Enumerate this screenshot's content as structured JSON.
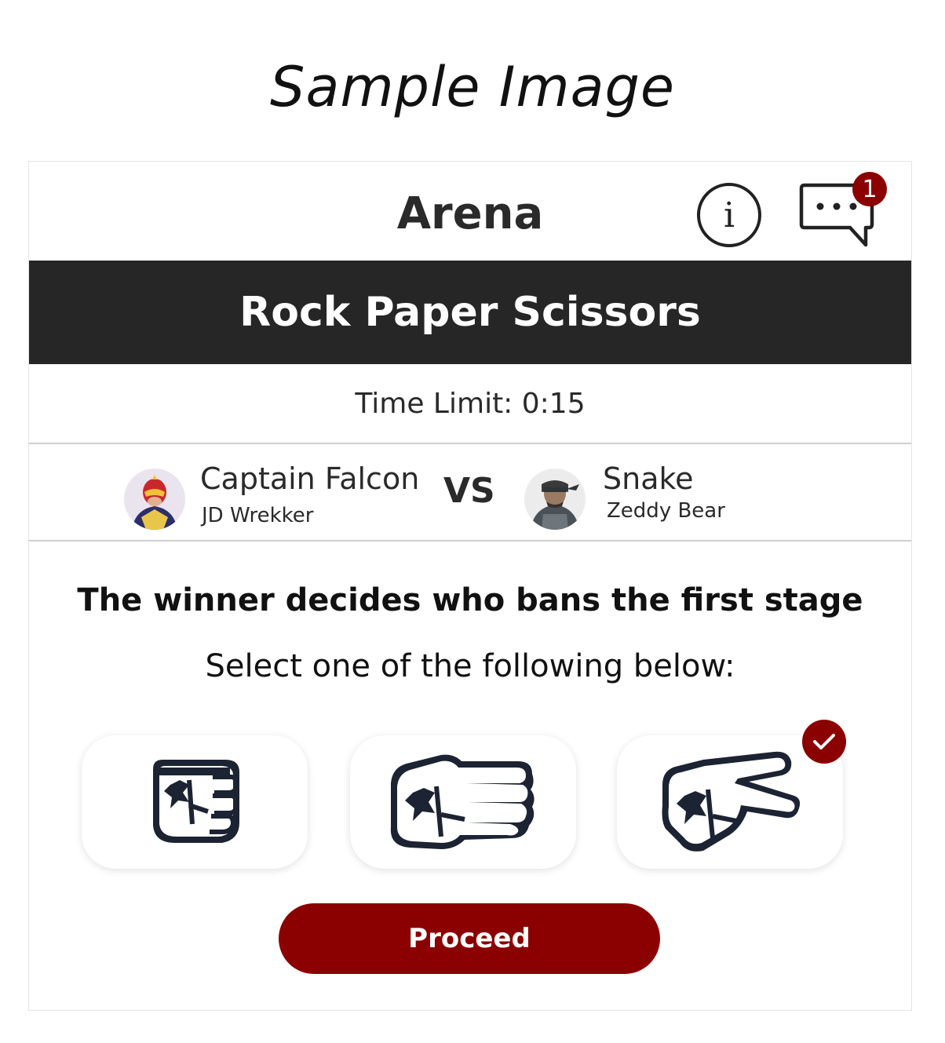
{
  "sample_caption": "Sample Image",
  "header": {
    "title": "Arena",
    "info_icon": "info-icon",
    "chat_icon": "chat-bubble-icon",
    "chat_badge_count": "1"
  },
  "banner": {
    "title": "Rock Paper Scissors"
  },
  "timer": {
    "label": "Time Limit: 0:15"
  },
  "matchup": {
    "vs_label": "VS",
    "player1": {
      "character": "Captain Falcon",
      "tag": "JD Wrekker",
      "avatar_icon": "captain-falcon-avatar"
    },
    "player2": {
      "character": "Snake",
      "tag": "Zeddy Bear",
      "avatar_icon": "snake-avatar"
    }
  },
  "prompt": {
    "heading": "The winner decides who bans the first stage",
    "subheading": "Select one of the following below:"
  },
  "choices": [
    {
      "id": "rock",
      "icon": "rock-fist-icon",
      "selected": false
    },
    {
      "id": "paper",
      "icon": "paper-hand-icon",
      "selected": false
    },
    {
      "id": "scissors",
      "icon": "scissors-hand-icon",
      "selected": true
    }
  ],
  "actions": {
    "proceed_label": "Proceed"
  },
  "colors": {
    "accent": "#8b0000",
    "banner_bg": "#262626"
  }
}
